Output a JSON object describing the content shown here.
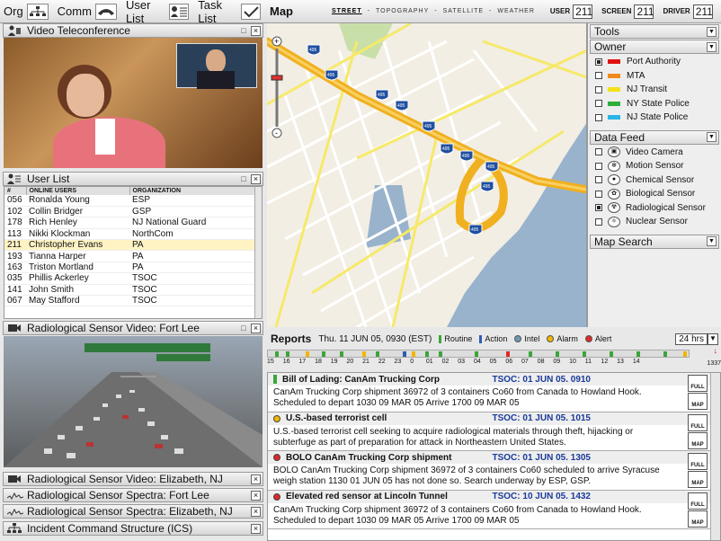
{
  "toolbar": {
    "org": "Org",
    "comm": "Comm",
    "user_list": "User List",
    "task_list": "Task List"
  },
  "video_panel": {
    "title": "Video Teleconference"
  },
  "user_list": {
    "title": "User List",
    "columns": [
      "#",
      "ONLINE USERS",
      "ORGANIZATION"
    ],
    "rows": [
      {
        "id": "056",
        "name": "Ronalda Young",
        "org": "ESP"
      },
      {
        "id": "102",
        "name": "Collin Bridger",
        "org": "GSP"
      },
      {
        "id": "178",
        "name": "Rich Henley",
        "org": "NJ National Guard"
      },
      {
        "id": "113",
        "name": "Nikki Klockman",
        "org": "NorthCom"
      },
      {
        "id": "211",
        "name": "Christopher Evans",
        "org": "PA"
      },
      {
        "id": "193",
        "name": "Tianna Harper",
        "org": "PA"
      },
      {
        "id": "163",
        "name": "Triston Mortland",
        "org": "PA"
      },
      {
        "id": "035",
        "name": "Phillis Ackerley",
        "org": "TSOC"
      },
      {
        "id": "141",
        "name": "John Smith",
        "org": "TSOC"
      },
      {
        "id": "067",
        "name": "May Stafford",
        "org": "TSOC"
      }
    ]
  },
  "sensor_video": {
    "title": "Radiological Sensor Video: Fort Lee"
  },
  "collapsed_panels": [
    "Radiological Sensor Video: Elizabeth, NJ",
    "Radiological Sensor Spectra: Fort Lee",
    "Radiological Sensor Spectra: Elizabeth, NJ",
    "Incident Command Structure (ICS)"
  ],
  "map": {
    "title": "Map",
    "tabs": [
      "STREET",
      "TOPOGRAPHY",
      "SATELLITE",
      "WEATHER"
    ],
    "active_tab": "STREET",
    "user_label": "USER",
    "user_val": "211",
    "screen_label": "SCREEN",
    "screen_val": "211",
    "driver_label": "DRIVER",
    "driver_val": "211",
    "shields": [
      "495",
      "495",
      "495",
      "495",
      "495",
      "495",
      "495",
      "495",
      "495",
      "495"
    ]
  },
  "tools": {
    "title": "Tools",
    "owner_title": "Owner",
    "owners": [
      {
        "label": "Port Authority",
        "color": "#e01010",
        "checked": true
      },
      {
        "label": "MTA",
        "color": "#f08a1c",
        "checked": false
      },
      {
        "label": "NJ Transit",
        "color": "#f2e21a",
        "checked": false
      },
      {
        "label": "NY State Police",
        "color": "#2eae3a",
        "checked": false
      },
      {
        "label": "NJ State Police",
        "color": "#2ab5e6",
        "checked": false
      }
    ],
    "datafeed_title": "Data Feed",
    "feeds": [
      {
        "label": "Video Camera",
        "checked": false
      },
      {
        "label": "Motion Sensor",
        "checked": false
      },
      {
        "label": "Chemical Sensor",
        "checked": false
      },
      {
        "label": "Biological Sensor",
        "checked": false
      },
      {
        "label": "Radiological Sensor",
        "checked": true
      },
      {
        "label": "Nuclear Sensor",
        "checked": false
      }
    ],
    "map_search": "Map Search"
  },
  "reports": {
    "title": "Reports",
    "date": "Thu. 11 JUN 05, 0930 (EST)",
    "legend": {
      "routine": "Routine",
      "action": "Action",
      "intel": "Intel",
      "alarm": "Alarm",
      "alert": "Alert"
    },
    "range": "24 hrs",
    "ticks": [
      "15",
      "16",
      "17",
      "18",
      "19",
      "20",
      "21",
      "22",
      "23",
      "0",
      "01",
      "02",
      "03",
      "04",
      "05",
      "06",
      "07",
      "08",
      "09",
      "10",
      "11",
      "12",
      "13",
      "14"
    ],
    "now": "1337",
    "items": [
      {
        "title": "Bill of Lading: CanAm Trucking Corp",
        "time": "TSOC: 01 JUN 05. 0910",
        "body": "CanAm Trucking Corp shipment 36972 of 3 containers Co60 from Canada to Howland Hook. Scheduled to depart 1030 09 MAR 05 Arrive 1700 09 MAR 05",
        "kind": "routine"
      },
      {
        "title": "U.S.-based terrorist cell",
        "time": "TSOC: 01 JUN 05. 1015",
        "body": "U.S.-based terrorist cell seeking to acquire radiological materials through theft, hijacking or subterfuge as part of preparation for attack in Northeastern United States.",
        "kind": "alarm"
      },
      {
        "title": "BOLO CanAm Trucking Corp shipment",
        "time": "TSOC: 01 JUN 05. 1305",
        "body": "BOLO CanAm Trucking Corp shipment 36972 of 3 containers Co60 scheduled to arrive Syracuse weigh station 1130 01 JUN 05 has not done so. Search underway by ESP, GSP.",
        "kind": "alert"
      },
      {
        "title": "Elevated red sensor at Lincoln Tunnel",
        "time": "TSOC: 10 JUN 05. 1432",
        "body": "CanAm Trucking Corp shipment 36972 of 3 containers Co60 from Canada to Howland Hook. Scheduled to depart 1030 09 MAR 05 Arrive 1700 09 MAR 05",
        "kind": "alert"
      }
    ],
    "full_label": "FULL",
    "map_label": "MAP"
  }
}
